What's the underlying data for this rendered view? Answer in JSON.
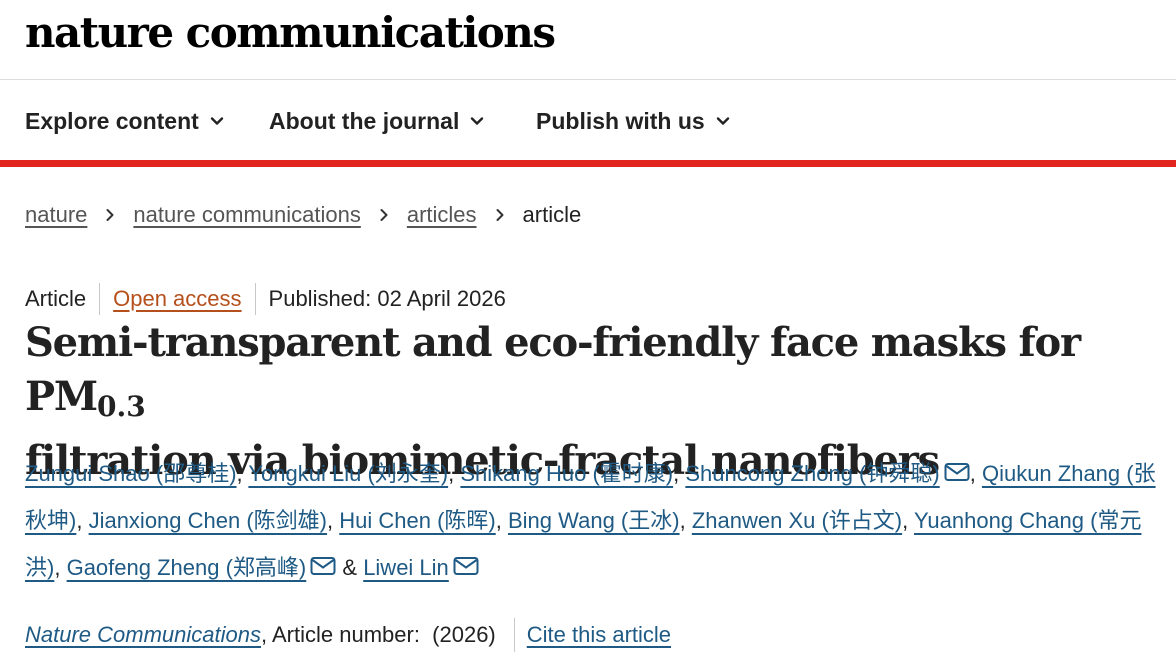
{
  "header": {
    "logo_text": "nature communications"
  },
  "nav": {
    "items": [
      {
        "label": "Explore content"
      },
      {
        "label": "About the journal"
      },
      {
        "label": "Publish with us"
      }
    ]
  },
  "breadcrumb": {
    "items": [
      {
        "label": "nature"
      },
      {
        "label": "nature communications"
      },
      {
        "label": "articles"
      }
    ],
    "current": "article"
  },
  "article": {
    "type": "Article",
    "access": "Open access",
    "published": "Published: 02 April 2026",
    "title_part1": "Semi-transparent and eco-friendly face masks for PM",
    "title_sub": "0.3",
    "title_part2": "filtration via biomimetic-fractal nanofibers",
    "authors": [
      "Zungui Shao (邵尊桂)",
      "Yongkui Liu (刘永奎)",
      "Shikang Huo (霍时康)",
      "Shuncong Zhong (钟舜聪)",
      "Qiukun Zhang (张秋坤)",
      "Jianxiong Chen (陈剑雄)",
      "Hui Chen (陈晖)",
      "Bing Wang (王冰)",
      "Zhanwen Xu (许占文)",
      "Yuanhong Chang (常元洪)",
      "Gaofeng Zheng (郑高峰)",
      "Liwei Lin"
    ],
    "sep_comma": ",",
    "sep_amp": "&",
    "journal": "Nature Communications",
    "article_number": ", Article number:  (2026)",
    "cite": "Cite this article"
  },
  "colors": {
    "accent_red": "#e0261f",
    "link_blue": "#1f5a85",
    "open_access_orange": "#b5501c"
  },
  "icons": [
    "chevron-down-icon",
    "chevron-right-icon",
    "mail-icon"
  ]
}
